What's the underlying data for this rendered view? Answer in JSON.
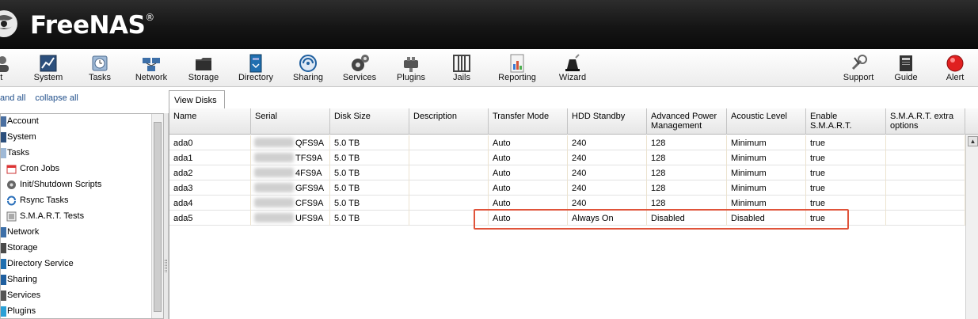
{
  "app": {
    "brand": "FreeNAS",
    "trademark": "®"
  },
  "toolbar": {
    "items": [
      {
        "id": "account",
        "label": "unt",
        "icon": "account-icon"
      },
      {
        "id": "system",
        "label": "System",
        "icon": "system-icon"
      },
      {
        "id": "tasks",
        "label": "Tasks",
        "icon": "tasks-icon"
      },
      {
        "id": "network",
        "label": "Network",
        "icon": "network-icon"
      },
      {
        "id": "storage",
        "label": "Storage",
        "icon": "storage-icon"
      },
      {
        "id": "directory",
        "label": "Directory",
        "icon": "directory-icon"
      },
      {
        "id": "sharing",
        "label": "Sharing",
        "icon": "sharing-icon"
      },
      {
        "id": "services",
        "label": "Services",
        "icon": "services-icon"
      },
      {
        "id": "plugins",
        "label": "Plugins",
        "icon": "plugins-icon"
      },
      {
        "id": "jails",
        "label": "Jails",
        "icon": "jails-icon"
      },
      {
        "id": "reporting",
        "label": "Reporting",
        "icon": "reporting-icon"
      },
      {
        "id": "wizard",
        "label": "Wizard",
        "icon": "wizard-icon"
      },
      {
        "id": "support",
        "label": "Support",
        "icon": "support-icon"
      },
      {
        "id": "guide",
        "label": "Guide",
        "icon": "guide-icon"
      },
      {
        "id": "alert",
        "label": "Alert",
        "icon": "alert-icon"
      }
    ]
  },
  "tree": {
    "expand_all": "and all",
    "collapse_all": "collapse all",
    "items": [
      {
        "label": "Account",
        "icon": "account-folder-icon"
      },
      {
        "label": "System",
        "icon": "system-folder-icon"
      },
      {
        "label": "Tasks",
        "icon": "tasks-folder-icon"
      },
      {
        "label": "Cron Jobs",
        "icon": "calendar-icon"
      },
      {
        "label": "Init/Shutdown Scripts",
        "icon": "script-icon"
      },
      {
        "label": "Rsync Tasks",
        "icon": "sync-icon"
      },
      {
        "label": "S.M.A.R.T. Tests",
        "icon": "smart-test-icon"
      },
      {
        "label": "Network",
        "icon": "network-folder-icon"
      },
      {
        "label": "Storage",
        "icon": "storage-folder-icon"
      },
      {
        "label": "Directory Service",
        "icon": "directory-folder-icon"
      },
      {
        "label": "Sharing",
        "icon": "sharing-folder-icon"
      },
      {
        "label": "Services",
        "icon": "services-folder-icon"
      },
      {
        "label": "Plugins",
        "icon": "plugins-folder-icon"
      }
    ]
  },
  "tab": {
    "label": "View Disks"
  },
  "grid": {
    "columns": [
      {
        "line1": "Name",
        "line2": ""
      },
      {
        "line1": "Serial",
        "line2": ""
      },
      {
        "line1": "Disk Size",
        "line2": ""
      },
      {
        "line1": "Description",
        "line2": ""
      },
      {
        "line1": "Transfer Mode",
        "line2": ""
      },
      {
        "line1": "HDD Standby",
        "line2": ""
      },
      {
        "line1": "Advanced Power",
        "line2": "Management"
      },
      {
        "line1": "Acoustic Level",
        "line2": ""
      },
      {
        "line1": "Enable",
        "line2": "S.M.A.R.T."
      },
      {
        "line1": "S.M.A.R.T. extra",
        "line2": "options"
      }
    ],
    "rows": [
      [
        "ada0",
        "QFS9A",
        "5.0 TB",
        "",
        "Auto",
        "240",
        "128",
        "Minimum",
        "true",
        ""
      ],
      [
        "ada1",
        "TFS9A",
        "5.0 TB",
        "",
        "Auto",
        "240",
        "128",
        "Minimum",
        "true",
        ""
      ],
      [
        "ada2",
        "4FS9A",
        "5.0 TB",
        "",
        "Auto",
        "240",
        "128",
        "Minimum",
        "true",
        ""
      ],
      [
        "ada3",
        "GFS9A",
        "5.0 TB",
        "",
        "Auto",
        "240",
        "128",
        "Minimum",
        "true",
        ""
      ],
      [
        "ada4",
        "CFS9A",
        "5.0 TB",
        "",
        "Auto",
        "240",
        "128",
        "Minimum",
        "true",
        ""
      ],
      [
        "ada5",
        "UFS9A",
        "5.0 TB",
        "",
        "Auto",
        "Always On",
        "Disabled",
        "Disabled",
        "true",
        ""
      ]
    ],
    "highlight_color": "#e0533a"
  }
}
